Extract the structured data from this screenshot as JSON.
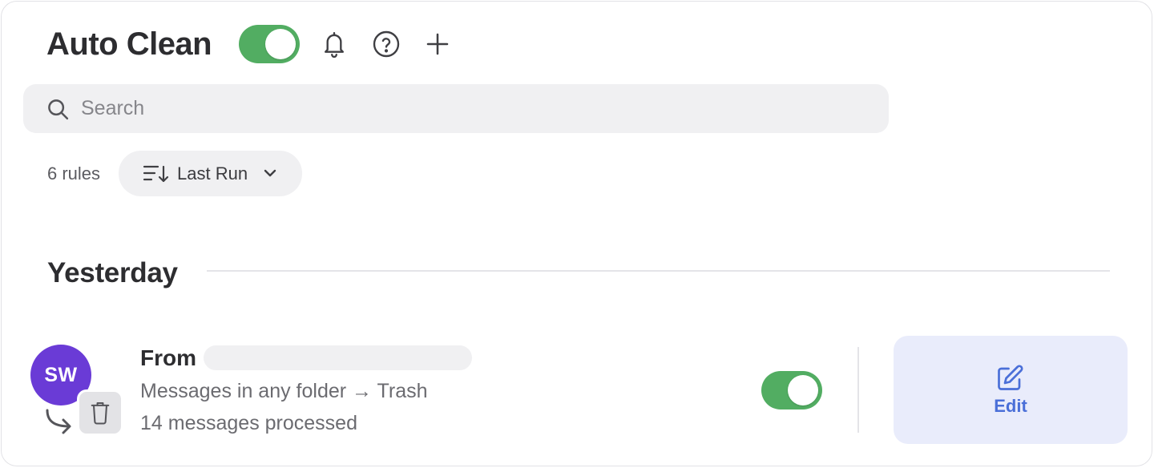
{
  "header": {
    "title": "Auto Clean",
    "enabled": true,
    "icons": [
      "bell-icon",
      "help-icon",
      "plus-icon"
    ]
  },
  "search": {
    "placeholder": "Search",
    "value": ""
  },
  "rules": {
    "count_label": "6 rules",
    "sort_label": "Last Run"
  },
  "sections": [
    {
      "title": "Yesterday",
      "items": [
        {
          "avatar_initials": "SW",
          "from_label": "From",
          "description": "Messages in any folder → Trash",
          "stats": "14 messages processed",
          "enabled": true,
          "edit_label": "Edit"
        }
      ]
    }
  ],
  "colors": {
    "toggle_on": "#52ad62",
    "avatar": "#6a3bd6",
    "edit_accent": "#4a6fd8",
    "edit_bg": "#e9ecfb"
  }
}
